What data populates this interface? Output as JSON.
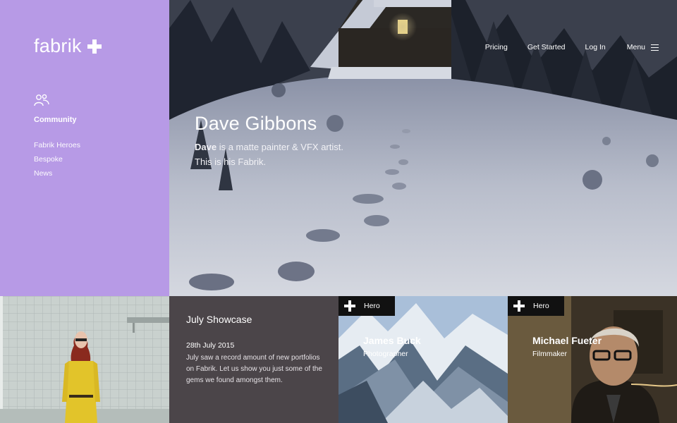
{
  "brand": {
    "name": "fabrik"
  },
  "sidebar": {
    "section_label": "Community",
    "items": [
      {
        "label": "Fabrik Heroes"
      },
      {
        "label": "Bespoke"
      },
      {
        "label": "News"
      }
    ]
  },
  "nav": {
    "items": [
      {
        "label": "Pricing"
      },
      {
        "label": "Get Started"
      },
      {
        "label": "Log In"
      }
    ],
    "menu_label": "Menu"
  },
  "hero": {
    "name": "Dave Gibbons",
    "desc_bold": "Dave",
    "desc_rest": " is a matte painter & VFX artist.",
    "desc_line2": "This is his Fabrik."
  },
  "showcase": {
    "title": "July Showcase",
    "date": "28th July 2015",
    "body": "July saw a record amount of new portfolios on Fabrik. Let us show you just some of the gems we found amongst them."
  },
  "featured": [
    {
      "tag": "Hero",
      "name": "James Buck",
      "role": "Photographer"
    },
    {
      "tag": "Hero",
      "name": "Michael Fueter",
      "role": "Filmmaker"
    }
  ],
  "colors": {
    "sidebar": "#b79ae6",
    "showcase_bg": "#4b4549",
    "tag_bg": "#111111"
  }
}
